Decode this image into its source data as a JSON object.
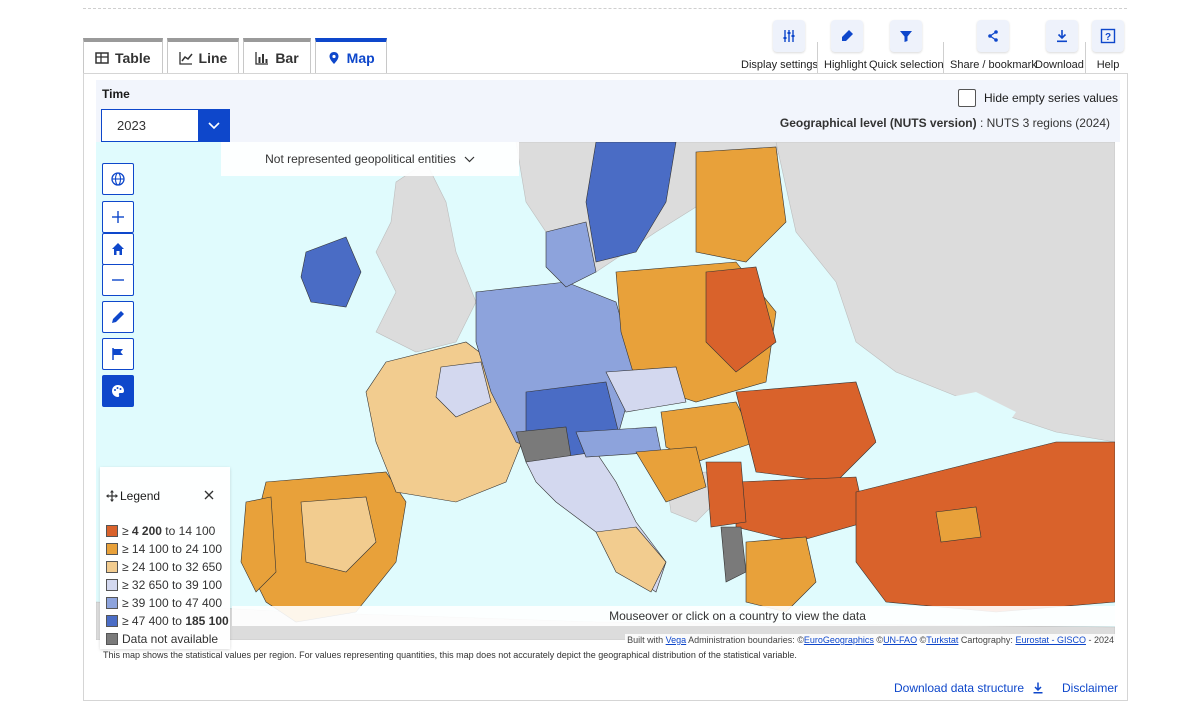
{
  "tabs": [
    {
      "label": "Table",
      "icon": "table-icon"
    },
    {
      "label": "Line",
      "icon": "line-chart-icon"
    },
    {
      "label": "Bar",
      "icon": "bar-chart-icon"
    },
    {
      "label": "Map",
      "icon": "map-pin-icon",
      "active": true
    }
  ],
  "toolbar": {
    "display_settings": "Display settings",
    "highlight": "Highlight",
    "quick_selection": "Quick selection",
    "share": "Share / bookmark",
    "download": "Download",
    "help": "Help"
  },
  "filters": {
    "time_label": "Time",
    "time_value": "2023",
    "hide_empty": "Hide empty series values",
    "geo_level_label": "Geographical level  (NUTS version)",
    "geo_level_value": " : NUTS 3 regions (2024)"
  },
  "map": {
    "not_represented": "Not represented geopolitical entities",
    "mouseover": "Mouseover or click on a country to view the data",
    "attribution": {
      "built_with": "Built with ",
      "vega": "Vega",
      "admin": " Administration boundaries: ©",
      "eurogeo": "EuroGeographics",
      "sep1": " ©",
      "unfao": "UN-FAO",
      "sep2": " ©",
      "turkstat": "Turkstat",
      "cart": " Cartography: ",
      "gisco": "Eurostat - GISCO",
      "year": " - 2024"
    },
    "note": "This map shows the statistical values per region. For values representing quantities, this map does not accurately depict the geographical distribution of the statistical variable."
  },
  "legend": {
    "title": "Legend",
    "classes": [
      {
        "prefix": "≥ ",
        "low": "4 200",
        "mid": " to ",
        "high": "14 100",
        "bold_low": true,
        "bold_high": false,
        "color": "#d9622b"
      },
      {
        "prefix": "≥ ",
        "low": "14 100",
        "mid": " to ",
        "high": "24 100",
        "bold_low": false,
        "bold_high": false,
        "color": "#e8a13a"
      },
      {
        "prefix": "≥ ",
        "low": "24 100",
        "mid": " to ",
        "high": "32 650",
        "bold_low": false,
        "bold_high": false,
        "color": "#f2cc8f"
      },
      {
        "prefix": "≥ ",
        "low": "32 650",
        "mid": " to ",
        "high": "39 100",
        "bold_low": false,
        "bold_high": false,
        "color": "#d3d8ef"
      },
      {
        "prefix": "≥ ",
        "low": "39 100",
        "mid": " to ",
        "high": "47 400",
        "bold_low": false,
        "bold_high": false,
        "color": "#8da3dc"
      },
      {
        "prefix": "≥ ",
        "low": "47 400",
        "mid": " to ",
        "high": "185 100",
        "bold_low": false,
        "bold_high": true,
        "color": "#4a6cc5"
      },
      {
        "prefix": "",
        "low": "Data not available",
        "mid": "",
        "high": "",
        "bold_low": false,
        "bold_high": false,
        "color": "#7a7a7a"
      }
    ]
  },
  "footer": {
    "download_structure": "Download data structure",
    "disclaimer": "Disclaimer"
  },
  "colors": {
    "accent": "#0e47cb",
    "sea": "#e0fbfd",
    "non_eu_land": "#dcdcdc"
  }
}
